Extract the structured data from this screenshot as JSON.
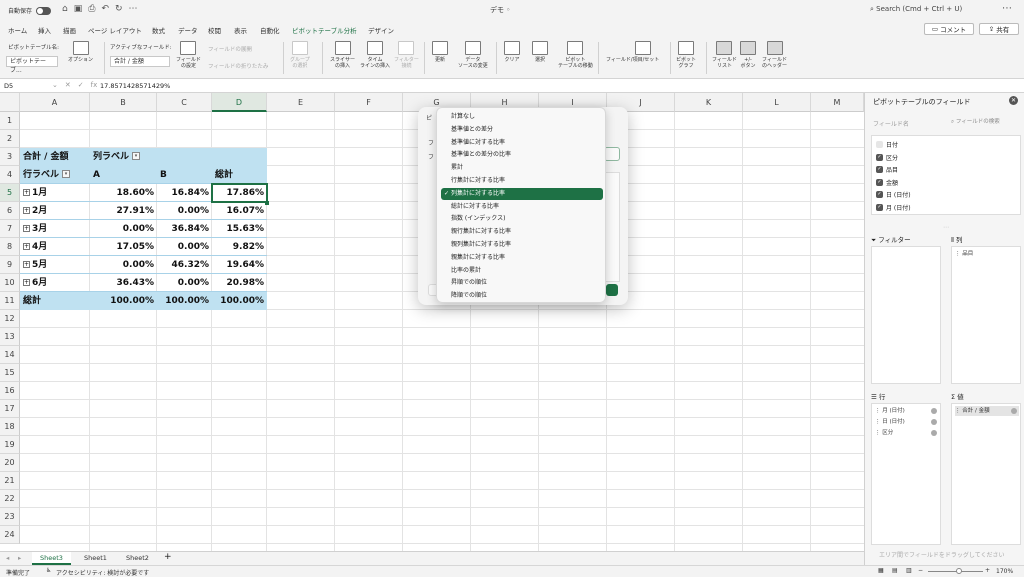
{
  "titlebar": {
    "autosave_label": "自動保存",
    "doc_title": "デモ ◦",
    "search_placeholder": "Search (Cmd + Ctrl + U)"
  },
  "tabs": [
    "ホーム",
    "挿入",
    "描画",
    "ページ レイアウト",
    "数式",
    "データ",
    "校閲",
    "表示",
    "自動化",
    "ピボットテーブル分析",
    "デザイン"
  ],
  "active_tab": "ピボットテーブル分析",
  "buttons": {
    "comment": "コメント",
    "share": "共有"
  },
  "ribbon": {
    "pivot_name_label": "ピボットテーブル名:",
    "pivot_name_value": "ピボットテーブ...",
    "options": "オプション",
    "active_field_label": "アクティブなフィールド:",
    "active_field_value": "合計 / 金額",
    "field_settings": "フィールド\nの設定",
    "expand_field": "フィールドの展開",
    "collapse_field": "フィールドの折りたたみ",
    "group_selection": "グループ\nの選択",
    "insert_slicer": "スライサー\nの挿入",
    "insert_timeline": "タイム\nラインの挿入",
    "filter_connections": "フィルター\n接続",
    "refresh": "更新",
    "change_source": "データ\nソースの変更",
    "clear": "クリア",
    "select": "選択",
    "move_pivot": "ピボット\nテーブルの移動",
    "fields_items_sets": "フィールド/項目/セット",
    "pivot_chart": "ピボット\nグラフ",
    "field_list": "フィールド\nリスト",
    "plus_minus_buttons": "+/-\nボタン",
    "field_headers": "フィールド\nのヘッダー"
  },
  "formula_bar": {
    "name_box": "D5",
    "formula": "17.8571428571429%"
  },
  "grid": {
    "columns": [
      "A",
      "B",
      "C",
      "D",
      "E",
      "F",
      "G",
      "H",
      "I",
      "J",
      "K",
      "L",
      "M"
    ],
    "rows": [
      "1",
      "2",
      "3",
      "4",
      "5",
      "6",
      "7",
      "8",
      "9",
      "10",
      "11",
      "12",
      "13",
      "14",
      "15",
      "16",
      "17",
      "18",
      "19",
      "20",
      "21",
      "22",
      "23",
      "24"
    ]
  },
  "pivot": {
    "value_header": "合計 / 金額",
    "col_label_header": "列ラベル",
    "row_label_header": "行ラベル",
    "col_headers": [
      "A",
      "B",
      "総計"
    ],
    "rows": [
      {
        "label": "1月",
        "a": "18.60%",
        "b": "16.84%",
        "total": "17.86%"
      },
      {
        "label": "2月",
        "a": "27.91%",
        "b": "0.00%",
        "total": "16.07%"
      },
      {
        "label": "3月",
        "a": "0.00%",
        "b": "36.84%",
        "total": "15.63%"
      },
      {
        "label": "4月",
        "a": "17.05%",
        "b": "0.00%",
        "total": "9.82%"
      },
      {
        "label": "5月",
        "a": "0.00%",
        "b": "46.32%",
        "total": "19.64%"
      },
      {
        "label": "6月",
        "a": "36.43%",
        "b": "0.00%",
        "total": "20.98%"
      }
    ],
    "grand_total": {
      "label": "総計",
      "a": "100.00%",
      "b": "100.00%",
      "total": "100.00%"
    }
  },
  "dialog": {
    "frag_title": "ピ",
    "frag_f1": "フ",
    "frag_f2": "フ",
    "menu_items": [
      "計算なし",
      "基準値との差分",
      "基準値に対する比率",
      "基準値との差分の比率",
      "累計",
      "行集計に対する比率",
      "列集計に対する比率",
      "総計に対する比率",
      "指数 (インデックス)",
      "親行集計に対する比率",
      "親列集計に対する比率",
      "親集計に対する比率",
      "比率の累計",
      "昇順での順位",
      "降順での順位"
    ],
    "selected_item": "列集計に対する比率"
  },
  "sheets": [
    "Sheet3",
    "Sheet1",
    "Sheet2"
  ],
  "active_sheet": "Sheet3",
  "status": {
    "ready": "準備完了",
    "accessibility": "アクセシビリティ: 検討が必要です",
    "zoom": "170%"
  },
  "pane": {
    "title": "ピボットテーブルのフィールド",
    "field_name_label": "フィールド名",
    "search_placeholder": "フィールドの検索",
    "fields": [
      {
        "name": "日付",
        "checked": false
      },
      {
        "name": "区分",
        "checked": true
      },
      {
        "name": "品目",
        "checked": true
      },
      {
        "name": "金額",
        "checked": true
      },
      {
        "name": "日 (日付)",
        "checked": true
      },
      {
        "name": "月 (日付)",
        "checked": true
      }
    ],
    "filters_title": "フィルター",
    "columns_title": "列",
    "rows_title": "行",
    "values_title": "値",
    "columns_items": [
      "品目"
    ],
    "rows_items": [
      "月 (日付)",
      "日 (日付)",
      "区分"
    ],
    "values_items": [
      "合計 / 金額"
    ],
    "drag_hint": "エリア間でフィールドをドラッグしてください"
  }
}
